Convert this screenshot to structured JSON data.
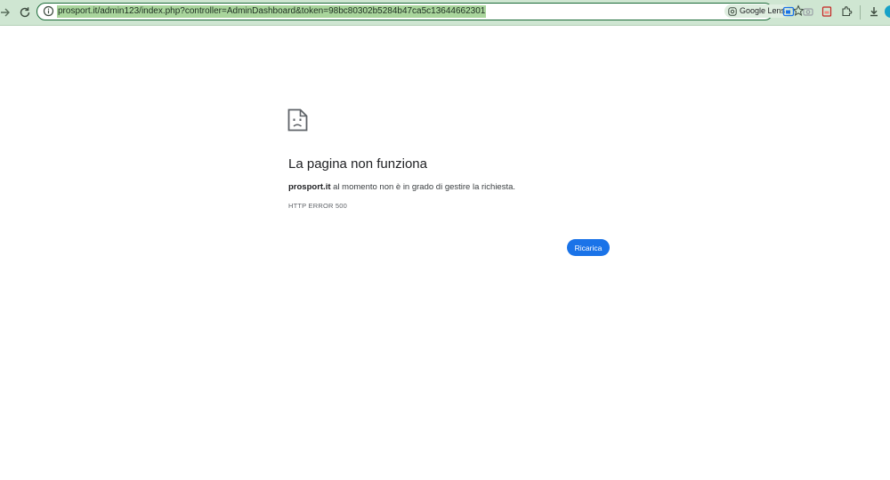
{
  "browser": {
    "url": "prosport.it/admin123/index.php?controller=AdminDashboard&token=98bc80302b5284b47ca5c13644662301",
    "lens_label": "Google Lens",
    "icons": [
      "forward-icon",
      "reload-icon",
      "site-info-icon",
      "google-lens-icon",
      "bookmark-star-icon",
      "extension-icons",
      "puzzle-icon",
      "download-icon",
      "profile-icon"
    ],
    "accent_color": "#cfe6d2"
  },
  "error": {
    "icon": "sad-page-icon",
    "title": "La pagina non funziona",
    "site": "prosport.it",
    "message": "al momento non è in grado di gestire la richiesta.",
    "code": "HTTP ERROR 500",
    "reload_label": "Ricarica",
    "button_color": "#1a73e8"
  }
}
